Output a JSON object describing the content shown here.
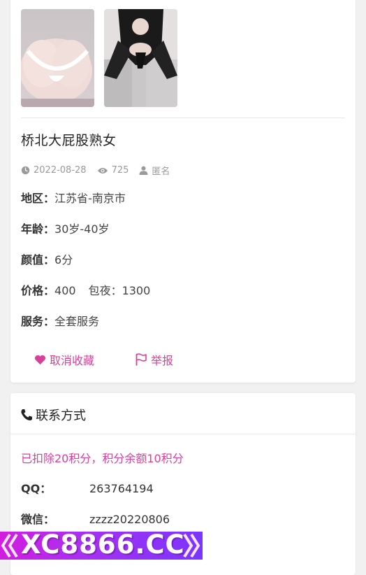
{
  "listing": {
    "title": "桥北大屁股熟女",
    "date": "2022-08-28",
    "views": "725",
    "author": "匿名",
    "fields": [
      {
        "label": "地区：",
        "value": "江苏省-南京市"
      },
      {
        "label": "年龄：",
        "value": "30岁-40岁"
      },
      {
        "label": "颜值：",
        "value": "6分"
      },
      {
        "label": "价格：",
        "value": "400",
        "extra": "包夜：1300"
      },
      {
        "label": "服务：",
        "value": "全套服务"
      }
    ],
    "favorite_label": "取消收藏",
    "report_label": "举报"
  },
  "contact": {
    "title": "联系方式",
    "notice": "已扣除20积分，积分余额10积分",
    "items": [
      {
        "label": "QQ：",
        "value": "263764194"
      },
      {
        "label": "微信：",
        "value": "zzzz20220806"
      }
    ]
  },
  "banner": {
    "text": "XC8866.CC"
  },
  "colors": {
    "accent": "#d9409a",
    "muted": "#999999"
  },
  "icons": [
    "clock-icon",
    "eye-icon",
    "user-icon",
    "heart-icon",
    "flag-icon",
    "phone-icon"
  ]
}
